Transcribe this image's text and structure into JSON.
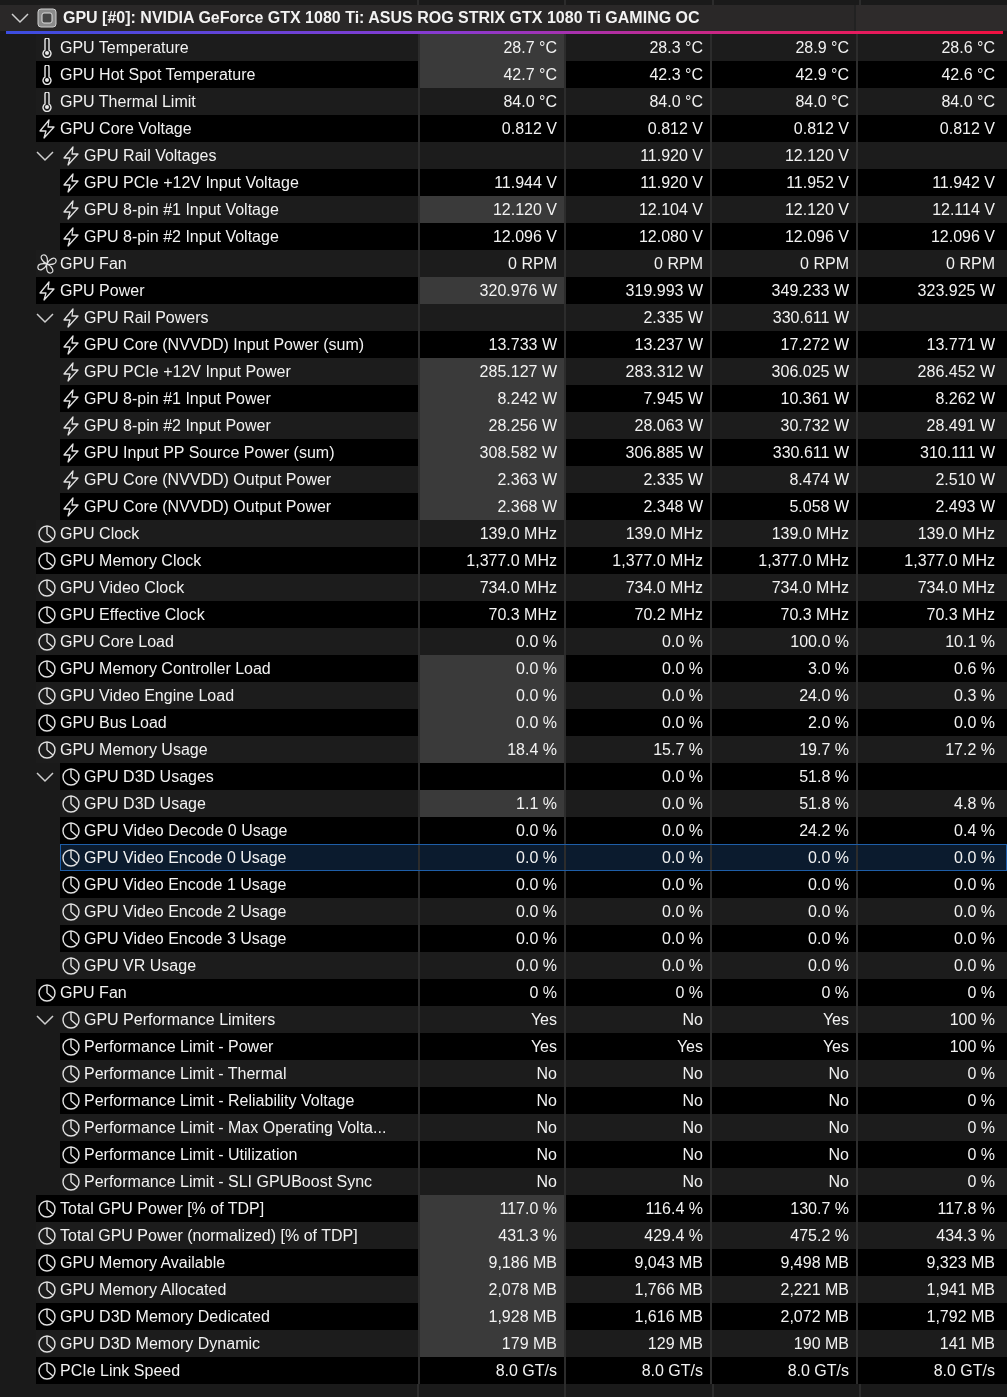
{
  "device": {
    "title": "GPU [#0]: NVIDIA GeForce GTX 1080 Ti: ASUS ROG STRIX GTX 1080 Ti GAMING OC",
    "expanded": true
  },
  "rows": [
    {
      "kind": "temperature",
      "label": "GPU Temperature",
      "column_1": "28.7 °C",
      "column_2": "28.3 °C",
      "column_3": "28.9 °C",
      "column_4": "28.6 °C",
      "highlighted": true,
      "selected": false
    },
    {
      "kind": "temperature",
      "label": "GPU Hot Spot Temperature",
      "column_1": "42.7 °C",
      "column_2": "42.3 °C",
      "column_3": "42.9 °C",
      "column_4": "42.6 °C",
      "highlighted": true,
      "selected": false
    },
    {
      "kind": "temperature",
      "label": "GPU Thermal Limit",
      "column_1": "84.0 °C",
      "column_2": "84.0 °C",
      "column_3": "84.0 °C",
      "column_4": "84.0 °C",
      "highlighted": false,
      "selected": false
    },
    {
      "kind": "voltage",
      "label": "GPU Core Voltage",
      "column_1": "0.812 V",
      "column_2": "0.812 V",
      "column_3": "0.812 V",
      "column_4": "0.812 V",
      "highlighted": false,
      "selected": false
    },
    {
      "kind": "voltage",
      "label": "GPU Rail Voltages",
      "column_2": "11.920 V",
      "column_3": "12.120 V",
      "highlighted": false,
      "selected": false,
      "expanded": true,
      "children": [
        {
          "kind": "voltage",
          "label": "GPU PCIe +12V Input Voltage",
          "column_1": "11.944 V",
          "column_2": "11.920 V",
          "column_3": "11.952 V",
          "column_4": "11.942 V",
          "highlighted": false,
          "selected": false
        },
        {
          "kind": "voltage",
          "label": "GPU 8-pin #1 Input Voltage",
          "column_1": "12.120 V",
          "column_2": "12.104 V",
          "column_3": "12.120 V",
          "column_4": "12.114 V",
          "highlighted": true,
          "selected": false
        },
        {
          "kind": "voltage",
          "label": "GPU 8-pin #2 Input Voltage",
          "column_1": "12.096 V",
          "column_2": "12.080 V",
          "column_3": "12.096 V",
          "column_4": "12.096 V",
          "highlighted": false,
          "selected": false
        }
      ]
    },
    {
      "kind": "fan",
      "label": "GPU Fan",
      "column_1": "0 RPM",
      "column_2": "0 RPM",
      "column_3": "0 RPM",
      "column_4": "0 RPM",
      "highlighted": false,
      "selected": false
    },
    {
      "kind": "voltage",
      "label": "GPU Power",
      "column_1": "320.976 W",
      "column_2": "319.993 W",
      "column_3": "349.233 W",
      "column_4": "323.925 W",
      "highlighted": true,
      "selected": false
    },
    {
      "kind": "voltage",
      "label": "GPU Rail Powers",
      "column_2": "2.335 W",
      "column_3": "330.611 W",
      "highlighted": false,
      "selected": false,
      "expanded": true,
      "children": [
        {
          "kind": "voltage",
          "label": "GPU Core (NVVDD) Input Power (sum)",
          "column_1": "13.733 W",
          "column_2": "13.237 W",
          "column_3": "17.272 W",
          "column_4": "13.771 W",
          "highlighted": false,
          "selected": false
        },
        {
          "kind": "voltage",
          "label": "GPU PCIe +12V Input Power",
          "column_1": "285.127 W",
          "column_2": "283.312 W",
          "column_3": "306.025 W",
          "column_4": "286.452 W",
          "highlighted": true,
          "selected": false
        },
        {
          "kind": "voltage",
          "label": "GPU 8-pin #1 Input Power",
          "column_1": "8.242 W",
          "column_2": "7.945 W",
          "column_3": "10.361 W",
          "column_4": "8.262 W",
          "highlighted": true,
          "selected": false
        },
        {
          "kind": "voltage",
          "label": "GPU 8-pin #2 Input Power",
          "column_1": "28.256 W",
          "column_2": "28.063 W",
          "column_3": "30.732 W",
          "column_4": "28.491 W",
          "highlighted": true,
          "selected": false
        },
        {
          "kind": "voltage",
          "label": "GPU Input PP Source Power (sum)",
          "column_1": "308.582 W",
          "column_2": "306.885 W",
          "column_3": "330.611 W",
          "column_4": "310.111 W",
          "highlighted": true,
          "selected": false
        },
        {
          "kind": "voltage",
          "label": "GPU Core (NVVDD) Output Power",
          "column_1": "2.363 W",
          "column_2": "2.335 W",
          "column_3": "8.474 W",
          "column_4": "2.510 W",
          "highlighted": true,
          "selected": false
        },
        {
          "kind": "voltage",
          "label": "GPU Core (NVVDD) Output Power",
          "column_1": "2.368 W",
          "column_2": "2.348 W",
          "column_3": "5.058 W",
          "column_4": "2.493 W",
          "highlighted": true,
          "selected": false
        }
      ]
    },
    {
      "kind": "clock",
      "label": "GPU Clock",
      "column_1": "139.0 MHz",
      "column_2": "139.0 MHz",
      "column_3": "139.0 MHz",
      "column_4": "139.0 MHz",
      "highlighted": false,
      "selected": false
    },
    {
      "kind": "clock",
      "label": "GPU Memory Clock",
      "column_1": "1,377.0 MHz",
      "column_2": "1,377.0 MHz",
      "column_3": "1,377.0 MHz",
      "column_4": "1,377.0 MHz",
      "highlighted": false,
      "selected": false
    },
    {
      "kind": "clock",
      "label": "GPU Video Clock",
      "column_1": "734.0 MHz",
      "column_2": "734.0 MHz",
      "column_3": "734.0 MHz",
      "column_4": "734.0 MHz",
      "highlighted": false,
      "selected": false
    },
    {
      "kind": "clock",
      "label": "GPU Effective Clock",
      "column_1": "70.3 MHz",
      "column_2": "70.2 MHz",
      "column_3": "70.3 MHz",
      "column_4": "70.3 MHz",
      "highlighted": false,
      "selected": false
    },
    {
      "kind": "clock",
      "label": "GPU Core Load",
      "column_1": "0.0 %",
      "column_2": "0.0 %",
      "column_3": "100.0 %",
      "column_4": "10.1 %",
      "highlighted": false,
      "selected": false
    },
    {
      "kind": "clock",
      "label": "GPU Memory Controller Load",
      "column_1": "0.0 %",
      "column_2": "0.0 %",
      "column_3": "3.0 %",
      "column_4": "0.6 %",
      "highlighted": true,
      "selected": false
    },
    {
      "kind": "clock",
      "label": "GPU Video Engine Load",
      "column_1": "0.0 %",
      "column_2": "0.0 %",
      "column_3": "24.0 %",
      "column_4": "0.3 %",
      "highlighted": true,
      "selected": false
    },
    {
      "kind": "clock",
      "label": "GPU Bus Load",
      "column_1": "0.0 %",
      "column_2": "0.0 %",
      "column_3": "2.0 %",
      "column_4": "0.0 %",
      "highlighted": true,
      "selected": false
    },
    {
      "kind": "clock",
      "label": "GPU Memory Usage",
      "column_1": "18.4 %",
      "column_2": "15.7 %",
      "column_3": "19.7 %",
      "column_4": "17.2 %",
      "highlighted": true,
      "selected": false
    },
    {
      "kind": "clock",
      "label": "GPU D3D Usages",
      "column_2": "0.0 %",
      "column_3": "51.8 %",
      "highlighted": false,
      "selected": false,
      "expanded": true,
      "children": [
        {
          "kind": "clock",
          "label": "GPU D3D Usage",
          "column_1": "1.1 %",
          "column_2": "0.0 %",
          "column_3": "51.8 %",
          "column_4": "4.8 %",
          "highlighted": true,
          "selected": false
        },
        {
          "kind": "clock",
          "label": "GPU Video Decode 0 Usage",
          "column_1": "0.0 %",
          "column_2": "0.0 %",
          "column_3": "24.2 %",
          "column_4": "0.4 %",
          "highlighted": false,
          "selected": false
        },
        {
          "kind": "clock",
          "label": "GPU Video Encode 0 Usage",
          "column_1": "0.0 %",
          "column_2": "0.0 %",
          "column_3": "0.0 %",
          "column_4": "0.0 %",
          "highlighted": false,
          "selected": true
        },
        {
          "kind": "clock",
          "label": "GPU Video Encode 1 Usage",
          "column_1": "0.0 %",
          "column_2": "0.0 %",
          "column_3": "0.0 %",
          "column_4": "0.0 %",
          "highlighted": false,
          "selected": false
        },
        {
          "kind": "clock",
          "label": "GPU Video Encode 2 Usage",
          "column_1": "0.0 %",
          "column_2": "0.0 %",
          "column_3": "0.0 %",
          "column_4": "0.0 %",
          "highlighted": false,
          "selected": false
        },
        {
          "kind": "clock",
          "label": "GPU Video Encode 3 Usage",
          "column_1": "0.0 %",
          "column_2": "0.0 %",
          "column_3": "0.0 %",
          "column_4": "0.0 %",
          "highlighted": false,
          "selected": false
        },
        {
          "kind": "clock",
          "label": "GPU VR Usage",
          "column_1": "0.0 %",
          "column_2": "0.0 %",
          "column_3": "0.0 %",
          "column_4": "0.0 %",
          "highlighted": false,
          "selected": false
        }
      ]
    },
    {
      "kind": "clock",
      "label": "GPU Fan",
      "column_1": "0 %",
      "column_2": "0 %",
      "column_3": "0 %",
      "column_4": "0 %",
      "highlighted": false,
      "selected": false
    },
    {
      "kind": "clock",
      "label": "GPU Performance Limiters",
      "column_1": "Yes",
      "column_2": "No",
      "column_3": "Yes",
      "column_4": "100 %",
      "highlighted": false,
      "selected": false,
      "expanded": true,
      "children": [
        {
          "kind": "clock",
          "label": "Performance Limit - Power",
          "column_1": "Yes",
          "column_2": "Yes",
          "column_3": "Yes",
          "column_4": "100 %",
          "highlighted": false,
          "selected": false
        },
        {
          "kind": "clock",
          "label": "Performance Limit - Thermal",
          "column_1": "No",
          "column_2": "No",
          "column_3": "No",
          "column_4": "0 %",
          "highlighted": false,
          "selected": false
        },
        {
          "kind": "clock",
          "label": "Performance Limit - Reliability Voltage",
          "column_1": "No",
          "column_2": "No",
          "column_3": "No",
          "column_4": "0 %",
          "highlighted": false,
          "selected": false
        },
        {
          "kind": "clock",
          "label": "Performance Limit - Max Operating Volta...",
          "column_1": "No",
          "column_2": "No",
          "column_3": "No",
          "column_4": "0 %",
          "highlighted": false,
          "selected": false
        },
        {
          "kind": "clock",
          "label": "Performance Limit - Utilization",
          "column_1": "No",
          "column_2": "No",
          "column_3": "No",
          "column_4": "0 %",
          "highlighted": false,
          "selected": false
        },
        {
          "kind": "clock",
          "label": "Performance Limit - SLI GPUBoost Sync",
          "column_1": "No",
          "column_2": "No",
          "column_3": "No",
          "column_4": "0 %",
          "highlighted": false,
          "selected": false
        }
      ]
    },
    {
      "kind": "clock",
      "label": "Total GPU Power [% of TDP]",
      "column_1": "117.0 %",
      "column_2": "116.4 %",
      "column_3": "130.7 %",
      "column_4": "117.8 %",
      "highlighted": true,
      "selected": false
    },
    {
      "kind": "clock",
      "label": "Total GPU Power (normalized) [% of TDP]",
      "column_1": "431.3 %",
      "column_2": "429.4 %",
      "column_3": "475.2 %",
      "column_4": "434.3 %",
      "highlighted": true,
      "selected": false
    },
    {
      "kind": "clock",
      "label": "GPU Memory Available",
      "column_1": "9,186 MB",
      "column_2": "9,043 MB",
      "column_3": "9,498 MB",
      "column_4": "9,323 MB",
      "highlighted": true,
      "selected": false
    },
    {
      "kind": "clock",
      "label": "GPU Memory Allocated",
      "column_1": "2,078 MB",
      "column_2": "1,766 MB",
      "column_3": "2,221 MB",
      "column_4": "1,941 MB",
      "highlighted": true,
      "selected": false
    },
    {
      "kind": "clock",
      "label": "GPU D3D Memory Dedicated",
      "column_1": "1,928 MB",
      "column_2": "1,616 MB",
      "column_3": "2,072 MB",
      "column_4": "1,792 MB",
      "highlighted": true,
      "selected": false
    },
    {
      "kind": "clock",
      "label": "GPU D3D Memory Dynamic",
      "column_1": "179 MB",
      "column_2": "129 MB",
      "column_3": "190 MB",
      "column_4": "141 MB",
      "highlighted": true,
      "selected": false
    },
    {
      "kind": "clock",
      "label": "PCIe Link Speed",
      "column_1": "8.0 GT/s",
      "column_2": "8.0 GT/s",
      "column_3": "8.0 GT/s",
      "column_4": "8.0 GT/s",
      "highlighted": false,
      "selected": false
    }
  ]
}
